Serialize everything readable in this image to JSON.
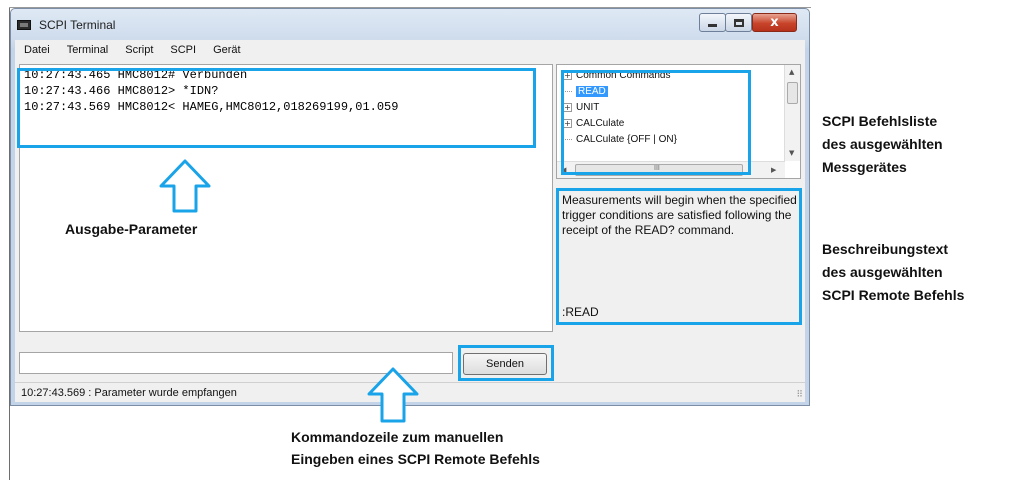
{
  "window": {
    "title": "SCPI Terminal",
    "close_glyph": "x"
  },
  "menu": [
    "Datei",
    "Terminal",
    "Script",
    "SCPI",
    "Gerät"
  ],
  "output": {
    "lines": [
      "10:27:43.465 HMC8012# Verbunden",
      "10:27:43.466 HMC8012> *IDN?",
      "10:27:43.569 HMC8012< HAMEG,HMC8012,018269199,01.059"
    ]
  },
  "tree": {
    "items": [
      {
        "label": "Common Commands",
        "toggle": "+",
        "selected": false
      },
      {
        "label": "READ",
        "toggle": "",
        "selected": true
      },
      {
        "label": "UNIT",
        "toggle": "+",
        "selected": false
      },
      {
        "label": "CALCulate",
        "toggle": "+",
        "selected": false
      },
      {
        "label": "CALCulate {OFF | ON}",
        "toggle": "",
        "selected": false
      }
    ],
    "hscroll_grip": "III"
  },
  "description": {
    "text": "Measurements will begin when the specified trigger conditions are satisfied following the receipt of the READ? command.",
    "command": ":READ"
  },
  "command_line": {
    "value": "",
    "send_label": "Senden"
  },
  "status": {
    "text": "10:27:43.569 : Parameter wurde empfangen"
  },
  "annotations": {
    "output_label": "Ausgabe-Parameter",
    "list_label_1": "SCPI Befehlsliste",
    "list_label_2": "des ausgewählten",
    "list_label_3": "Messgerätes",
    "desc_label_1": "Beschreibungstext",
    "desc_label_2": "des ausgewählten",
    "desc_label_3": "SCPI Remote Befehls",
    "cmd_label_1": "Kommandozeile zum manuellen",
    "cmd_label_2": "Eingeben eines SCPI Remote Befehls"
  },
  "colors": {
    "highlight": "#19a3e8",
    "selection": "#3399ff"
  }
}
